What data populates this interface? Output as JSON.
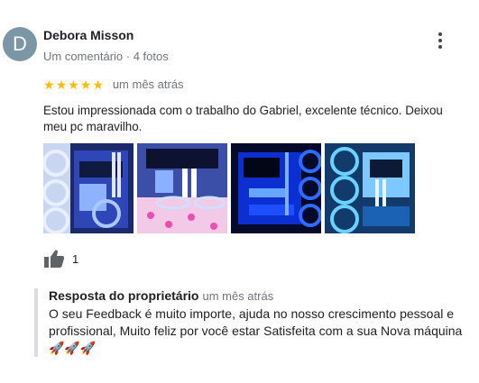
{
  "review": {
    "avatar_letter": "D",
    "avatar_color": "#7b96a4",
    "author": "Debora Misson",
    "meta": "Um comentário · 4 fotos",
    "rating": 5,
    "star_color": "#fbbc04",
    "date": "um mês atrás",
    "text": "Estou impressionada com o trabalho do Gabriel, excelente técnico. Deixou meu pc maravilho.",
    "menu_icon": "more-vert-icon",
    "photos": [
      {
        "name": "photo-1",
        "description_icon": "pc-build-photo"
      },
      {
        "name": "photo-2",
        "description_icon": "pc-build-photo"
      },
      {
        "name": "photo-3",
        "description_icon": "pc-build-photo"
      },
      {
        "name": "photo-4",
        "description_icon": "pc-build-photo"
      }
    ],
    "like_icon": "thumb-up-icon",
    "like_count": "1"
  },
  "reply": {
    "title": "Resposta do proprietário",
    "date": "um mês atrás",
    "text": "O seu Feedback é muito importe, ajuda no nosso crescimento pessoal e profissional, Muito feliz por você estar Satisfeita com a sua Nova máquina",
    "emoji": "🚀🚀🚀"
  }
}
